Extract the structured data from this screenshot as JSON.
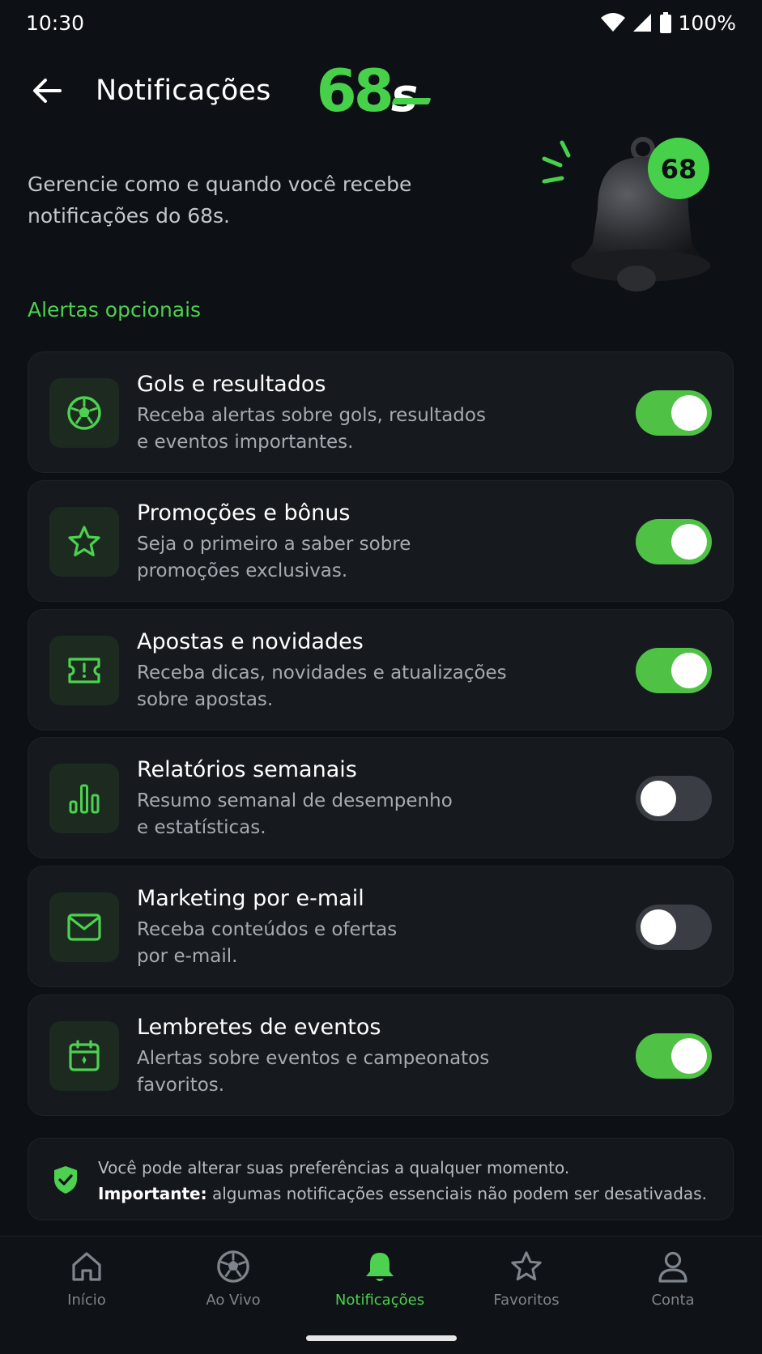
{
  "status_bar": {
    "time": "10:30",
    "battery": "100%"
  },
  "header": {
    "title": "Notificações",
    "logo_digits": "68",
    "logo_s": "s"
  },
  "intro": {
    "text": "Gerencie como e quando você recebe notificações do 68s."
  },
  "bell_badge": "68",
  "section_title": "Alertas opcionais",
  "settings": [
    {
      "title": "Gols e resultados",
      "desc_line1": "Receba alertas sobre gols, resultados",
      "desc_line2": "e eventos importantes.",
      "icon": "soccer-ball-icon",
      "enabled": true
    },
    {
      "title": "Promoções e bônus",
      "desc_line1": "Seja o primeiro a saber sobre",
      "desc_line2": "promoções exclusivas.",
      "icon": "star-icon",
      "enabled": true
    },
    {
      "title": "Apostas e novidades",
      "desc_line1": "Receba dicas, novidades e atualizações",
      "desc_line2": "sobre apostas.",
      "icon": "ticket-icon",
      "enabled": true
    },
    {
      "title": "Relatórios semanais",
      "desc_line1": "Resumo semanal de desempenho",
      "desc_line2": "e estatísticas.",
      "icon": "bar-chart-icon",
      "enabled": false
    },
    {
      "title": "Marketing por e-mail",
      "desc_line1": "Receba conteúdos e ofertas",
      "desc_line2": "por e-mail.",
      "icon": "mail-icon",
      "enabled": false
    },
    {
      "title": "Lembretes de eventos",
      "desc_line1": "Alertas sobre eventos e campeonatos",
      "desc_line2": "favoritos.",
      "icon": "calendar-icon",
      "enabled": true
    }
  ],
  "info": {
    "line1": "Você pode alterar suas preferências a qualquer momento.",
    "line2_bold": "Importante:",
    "line2_rest": " algumas notificações essenciais não podem ser desativadas."
  },
  "nav": [
    {
      "label": "Início",
      "icon": "home-icon",
      "active": false
    },
    {
      "label": "Ao Vivo",
      "icon": "soccer-ball-icon",
      "active": false
    },
    {
      "label": "Notificações",
      "icon": "bell-icon",
      "active": true
    },
    {
      "label": "Favoritos",
      "icon": "star-icon",
      "active": false
    },
    {
      "label": "Conta",
      "icon": "user-icon",
      "active": false
    }
  ],
  "colors": {
    "accent": "#4cd150",
    "background": "#0d1014",
    "card": "#161a1f",
    "toggle_off": "#3a3d44"
  }
}
